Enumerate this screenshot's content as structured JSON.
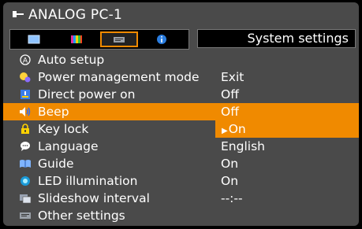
{
  "window": {
    "title": "ANALOG PC-1"
  },
  "tabs": {
    "items": [
      {
        "icon": "screen-icon"
      },
      {
        "icon": "color-bars-icon"
      },
      {
        "icon": "settings-card-icon",
        "active": true
      },
      {
        "icon": "info-icon"
      }
    ],
    "title": "System settings"
  },
  "menu": {
    "items": [
      {
        "id": "auto-setup",
        "icon": "a-circle-icon",
        "label": "Auto setup",
        "value": ""
      },
      {
        "id": "power-management",
        "icon": "power-mode-icon",
        "label": "Power management mode",
        "value": "Exit"
      },
      {
        "id": "direct-power",
        "icon": "direct-power-icon",
        "label": "Direct power on",
        "value": "Off"
      },
      {
        "id": "beep",
        "icon": "speaker-icon",
        "label": "Beep",
        "value": "Off",
        "selected": true
      },
      {
        "id": "key-lock",
        "icon": "lock-icon",
        "label": "Key lock",
        "value": "On",
        "editing": true
      },
      {
        "id": "language",
        "icon": "speech-bubble-icon",
        "label": "Language",
        "value": "English"
      },
      {
        "id": "guide",
        "icon": "book-icon",
        "label": "Guide",
        "value": "On"
      },
      {
        "id": "led",
        "icon": "led-icon",
        "label": "LED illumination",
        "value": "On"
      },
      {
        "id": "slideshow",
        "icon": "slideshow-icon",
        "label": "Slideshow interval",
        "value": "--:--"
      },
      {
        "id": "other",
        "icon": "other-settings-icon",
        "label": "Other settings",
        "value": ""
      }
    ]
  },
  "colors": {
    "accent": "#f08a00",
    "panel": "#4a4a4a",
    "bar": "#000000"
  }
}
